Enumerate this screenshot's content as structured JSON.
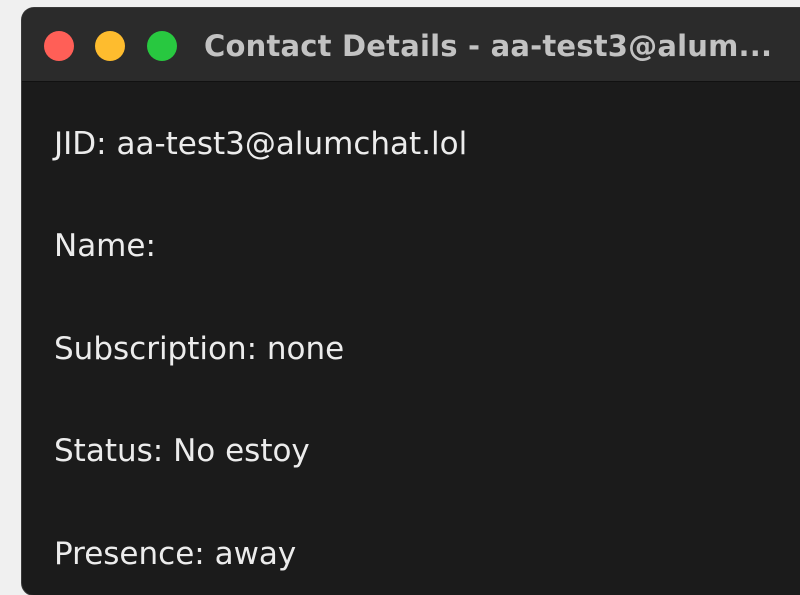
{
  "window": {
    "title": "Contact Details - aa-test3@alum..."
  },
  "traffic_lights": {
    "close_color": "#ff5f57",
    "minimize_color": "#febc2e",
    "maximize_color": "#28c840"
  },
  "fields": [
    {
      "text": "JID: aa-test3@alumchat.lol"
    },
    {
      "text": "Name:"
    },
    {
      "text": "Subscription: none"
    },
    {
      "text": "Status: No estoy"
    },
    {
      "text": "Presence: away"
    }
  ]
}
